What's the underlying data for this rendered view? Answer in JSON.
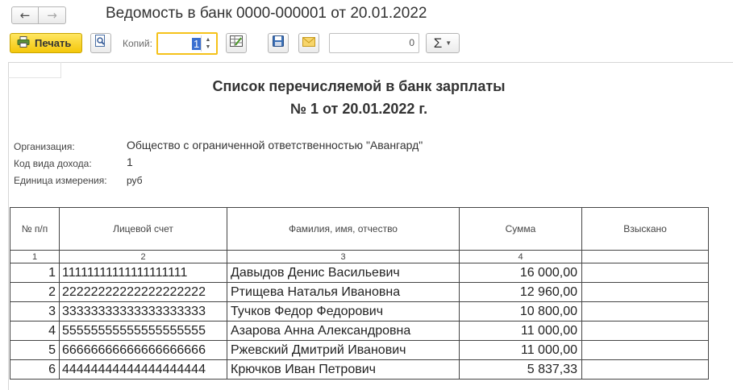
{
  "window": {
    "title": "Ведомость в банк 0000-000001 от 20.01.2022"
  },
  "nav": {
    "back": "←",
    "forward": "→"
  },
  "toolbar": {
    "print_label": "Печать",
    "copies_label": "Копий:",
    "copies_value": "1",
    "sum_value": "0",
    "sigma": "Σ"
  },
  "report": {
    "title_line1": "Список перечисляемой в банк зарплаты",
    "title_line2": "№  1 от 20.01.2022 г.",
    "org_label": "Организация:",
    "org_value": "Общество с ограниченной ответственностью \"Авангард\"",
    "income_label": "Код вида дохода:",
    "income_value": "1",
    "unit_label": "Единица измерения:",
    "unit_value": "руб"
  },
  "table": {
    "headers": [
      "№ п/п",
      "Лицевой счет",
      "Фамилия, имя, отчество",
      "Сумма",
      "Взыскано"
    ],
    "col_numbers": [
      "1",
      "2",
      "3",
      "4",
      ""
    ],
    "rows": [
      {
        "no": "1",
        "account": "11111111111111111111",
        "name": "Давыдов Денис Васильевич",
        "sum": "16 000,00",
        "withheld": ""
      },
      {
        "no": "2",
        "account": "22222222222222222222",
        "name": "Ртищева Наталья Ивановна",
        "sum": "12 960,00",
        "withheld": ""
      },
      {
        "no": "3",
        "account": "33333333333333333333",
        "name": "Тучков Федор Федорович",
        "sum": "10 800,00",
        "withheld": ""
      },
      {
        "no": "4",
        "account": "55555555555555555555",
        "name": "Азарова Анна Александровна",
        "sum": "11 000,00",
        "withheld": ""
      },
      {
        "no": "5",
        "account": "66666666666666666666",
        "name": "Ржевский Дмитрий Иванович",
        "sum": "11 000,00",
        "withheld": ""
      },
      {
        "no": "6",
        "account": "44444444444444444444",
        "name": "Крючков Иван Петрович",
        "sum": "5 837,33",
        "withheld": ""
      }
    ]
  },
  "colors": {
    "accent": "#f4c70b",
    "border": "#444444"
  }
}
